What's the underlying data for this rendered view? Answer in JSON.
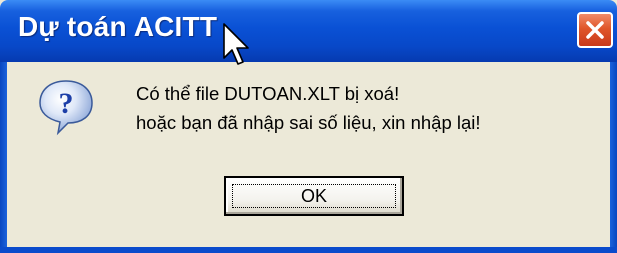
{
  "window": {
    "title": "Dự toán ACITT",
    "close_icon": "close-icon"
  },
  "message": {
    "icon": "question-icon",
    "line1": "Có thể file DUTOAN.XLT bị xoá!",
    "line2": "hoặc bạn đã nhập sai số liệu, xin nhập lại!"
  },
  "buttons": {
    "ok_label": "OK"
  },
  "colors": {
    "titlebar": "#0a51d5",
    "dialog_bg": "#ece9d8",
    "close_button": "#e0562a"
  }
}
